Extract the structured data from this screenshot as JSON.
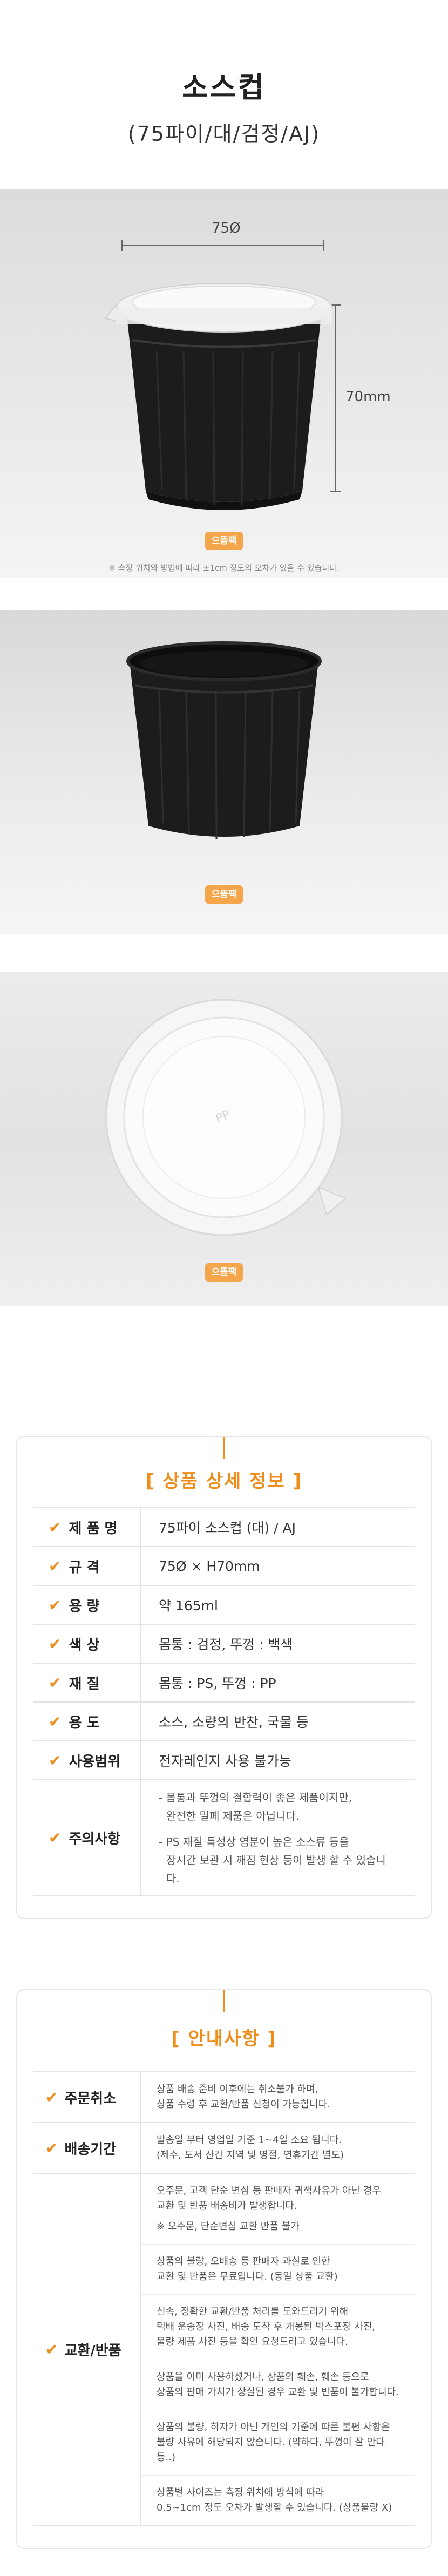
{
  "header": {
    "title": "소스컵",
    "subtitle": "(75파이/대/검정/AJ)"
  },
  "photo1": {
    "dim_width": "75Ø",
    "dim_height": "70mm",
    "logo_text": "으뜸팩",
    "note": "※ 측정 위치와 방법에 따라 ±1cm 정도의 오차가 있을 수 있습니다."
  },
  "photo2": {
    "logo_text": "으뜸팩"
  },
  "photo3": {
    "logo_text": "으뜸팩"
  },
  "detail": {
    "heading": "[ 상품 상세 정보 ]",
    "rows": [
      {
        "key": "제 품 명",
        "value": "75파이 소스컵 (대) / AJ"
      },
      {
        "key": "규    격",
        "value": "75Ø × H70mm"
      },
      {
        "key": "용    량",
        "value": "약 165ml"
      },
      {
        "key": "색    상",
        "value": "몸통 : 검정,  뚜껑 : 백색"
      },
      {
        "key": "재    질",
        "value": "몸통 : PS,  뚜껑 : PP"
      },
      {
        "key": "용    도",
        "value": "소스, 소량의 반찬, 국물 등"
      },
      {
        "key": "사용범위",
        "value": "전자레인지 사용 불가능"
      }
    ],
    "caution_key": "주의사항",
    "caution_lines": [
      "- 몸통과 뚜껑의 결합력이 좋은 제품이지만,",
      "완전한 밀폐 제품은 아닙니다.",
      "- PS 재질 특성상 염분이 높은 소스류 등을",
      "장시간 보관 시 깨짐 현상 등이 발생 할 수 있습니다."
    ]
  },
  "notice": {
    "heading": "[ 안내사항 ]",
    "cancel_key": "주문취소",
    "cancel_lines": [
      "상품 배송 준비 이후에는 취소불가 하며,",
      "상품 수령 후 교환/반품 신청이 가능합니다."
    ],
    "ship_key": "배송기간",
    "ship_lines": [
      "발송일 부터 영업일 기준 1~4일 소요 됩니다.",
      "(제주, 도서 산간 지역 및 명절, 연휴기간 별도)"
    ],
    "return_key": "교환/반품",
    "return_blocks": [
      [
        "오주문, 고객 단순 변심 등 판매자 귀책사유가 아닌 경우",
        "교환 및 반품 배송비가 발생합니다.",
        "※ 오주문, 단순변심 교환 반품 불가"
      ],
      [
        "상품의 불량, 오배송 등 판매자 과실로 인한",
        "교환 및 반품은 무료입니다. (동일 상품 교환)"
      ],
      [
        "신속, 정확한 교환/반품 처리를 도와드리기 위해",
        "택배 운송장 사진, 배송 도착 후 개봉된 박스포장 사진,",
        "불량 제품 사진 등을 확인 요청드리고 있습니다."
      ],
      [
        "상품을 이미 사용하셨거나, 상품의 훼손, 훼손 등으로",
        "상품의 판매 가치가 상실된 경우 교환 및 반품이 불가합니다."
      ],
      [
        "상품의 불량, 하자가 아닌 개인의 기준에 따른 불편 사항은",
        "불량 사유에 해당되지 않습니다. (약하다, 뚜껑이 잘 안다 등..)"
      ],
      [
        "상품별 사이즈는 측정 위치에 방식에 따라",
        "0.5~1cm 정도 오차가 발생할 수 있습니다. (상품불량 X)"
      ]
    ]
  }
}
